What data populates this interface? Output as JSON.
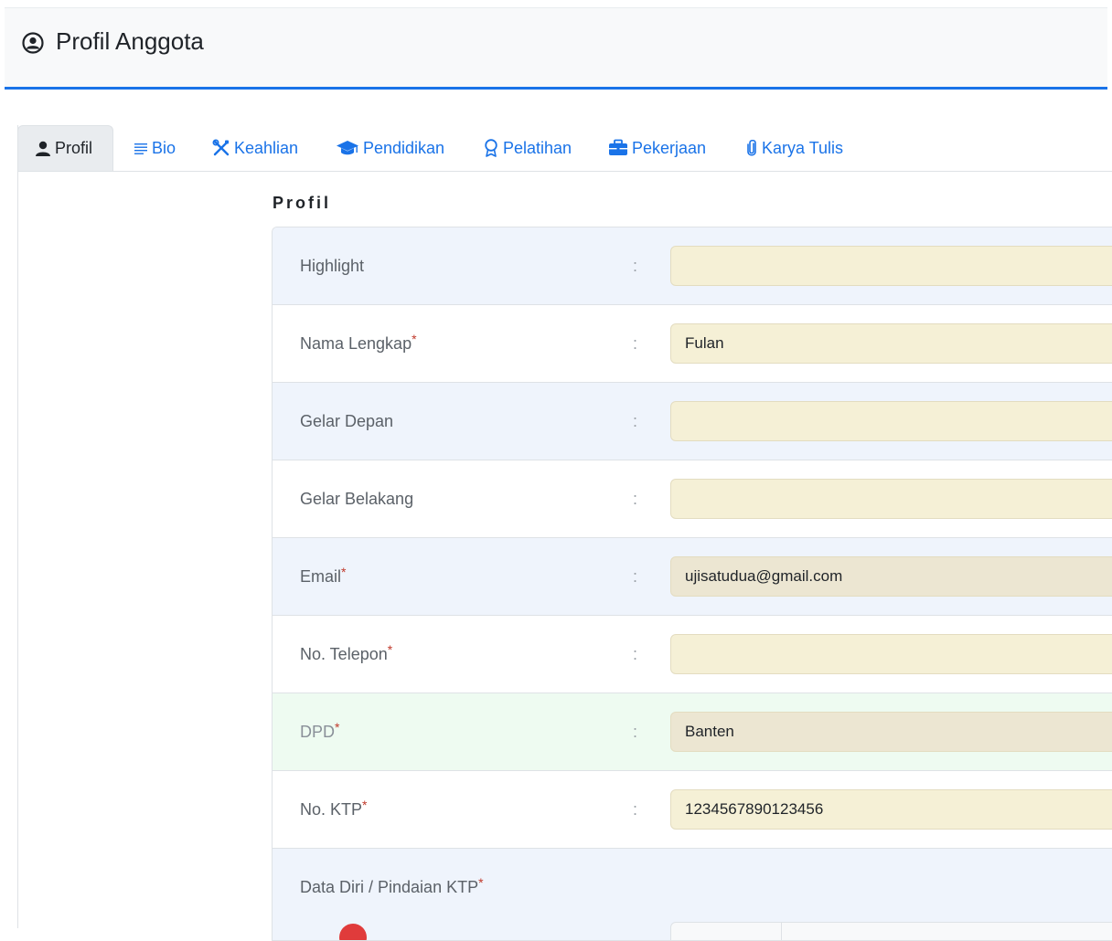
{
  "header": {
    "title": "Profil Anggota",
    "icon": "user-circle-icon"
  },
  "tabs": [
    {
      "label": "Profil",
      "icon": "user-icon",
      "active": true
    },
    {
      "label": "Bio",
      "icon": "lines-icon",
      "active": false
    },
    {
      "label": "Keahlian",
      "icon": "tools-icon",
      "active": false
    },
    {
      "label": "Pendidikan",
      "icon": "graduation-cap-icon",
      "active": false
    },
    {
      "label": "Pelatihan",
      "icon": "award-icon",
      "active": false
    },
    {
      "label": "Pekerjaan",
      "icon": "briefcase-icon",
      "active": false
    },
    {
      "label": "Karya Tulis",
      "icon": "paperclip-icon",
      "active": false
    }
  ],
  "section": {
    "title": "Profil"
  },
  "form": {
    "colon": ":",
    "required_mark": "*",
    "rows": [
      {
        "label": "Highlight",
        "value": ""
      },
      {
        "label": "Nama Lengkap",
        "value": "Fulan"
      },
      {
        "label": "Gelar Depan",
        "value": ""
      },
      {
        "label": "Gelar Belakang",
        "value": ""
      },
      {
        "label": "Email",
        "value": "ujisatudua@gmail.com"
      },
      {
        "label": "No. Telepon",
        "value": ""
      },
      {
        "label": "DPD",
        "value": "Banten"
      },
      {
        "label": "No. KTP",
        "value": "1234567890123456"
      },
      {
        "label": "Data Diri / Pindaian KTP"
      }
    ]
  },
  "colors": {
    "accent": "#1a73e8",
    "field_bg": "#f5f0d6",
    "row_blue": "#eff4fc",
    "row_green": "#eefbf1",
    "required": "#c0392b"
  }
}
